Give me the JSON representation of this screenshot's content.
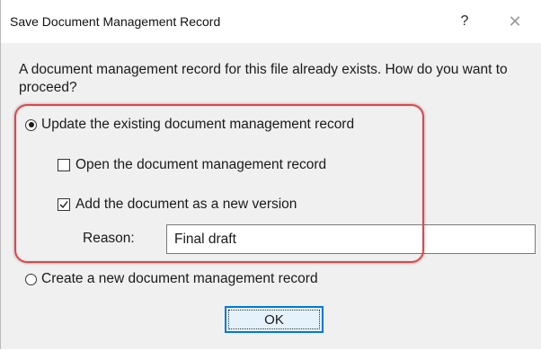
{
  "dialog": {
    "title": "Save Document Management Record",
    "help_label": "?",
    "close_label": "✕",
    "message": "A document management record for this file already exists.  How do you want to proceed?",
    "options": {
      "update_label": "Update the existing document management record",
      "update_selected": true,
      "open_label": "Open the document management record",
      "open_checked": false,
      "new_version_label": "Add the document as a new version",
      "new_version_checked": true,
      "reason_label": "Reason:",
      "reason_value": "Final draft",
      "create_label": "Create a new document management record",
      "create_selected": false
    },
    "ok_label": "OK",
    "highlight_color": "#e0464b",
    "accent_color": "#0078d7"
  }
}
